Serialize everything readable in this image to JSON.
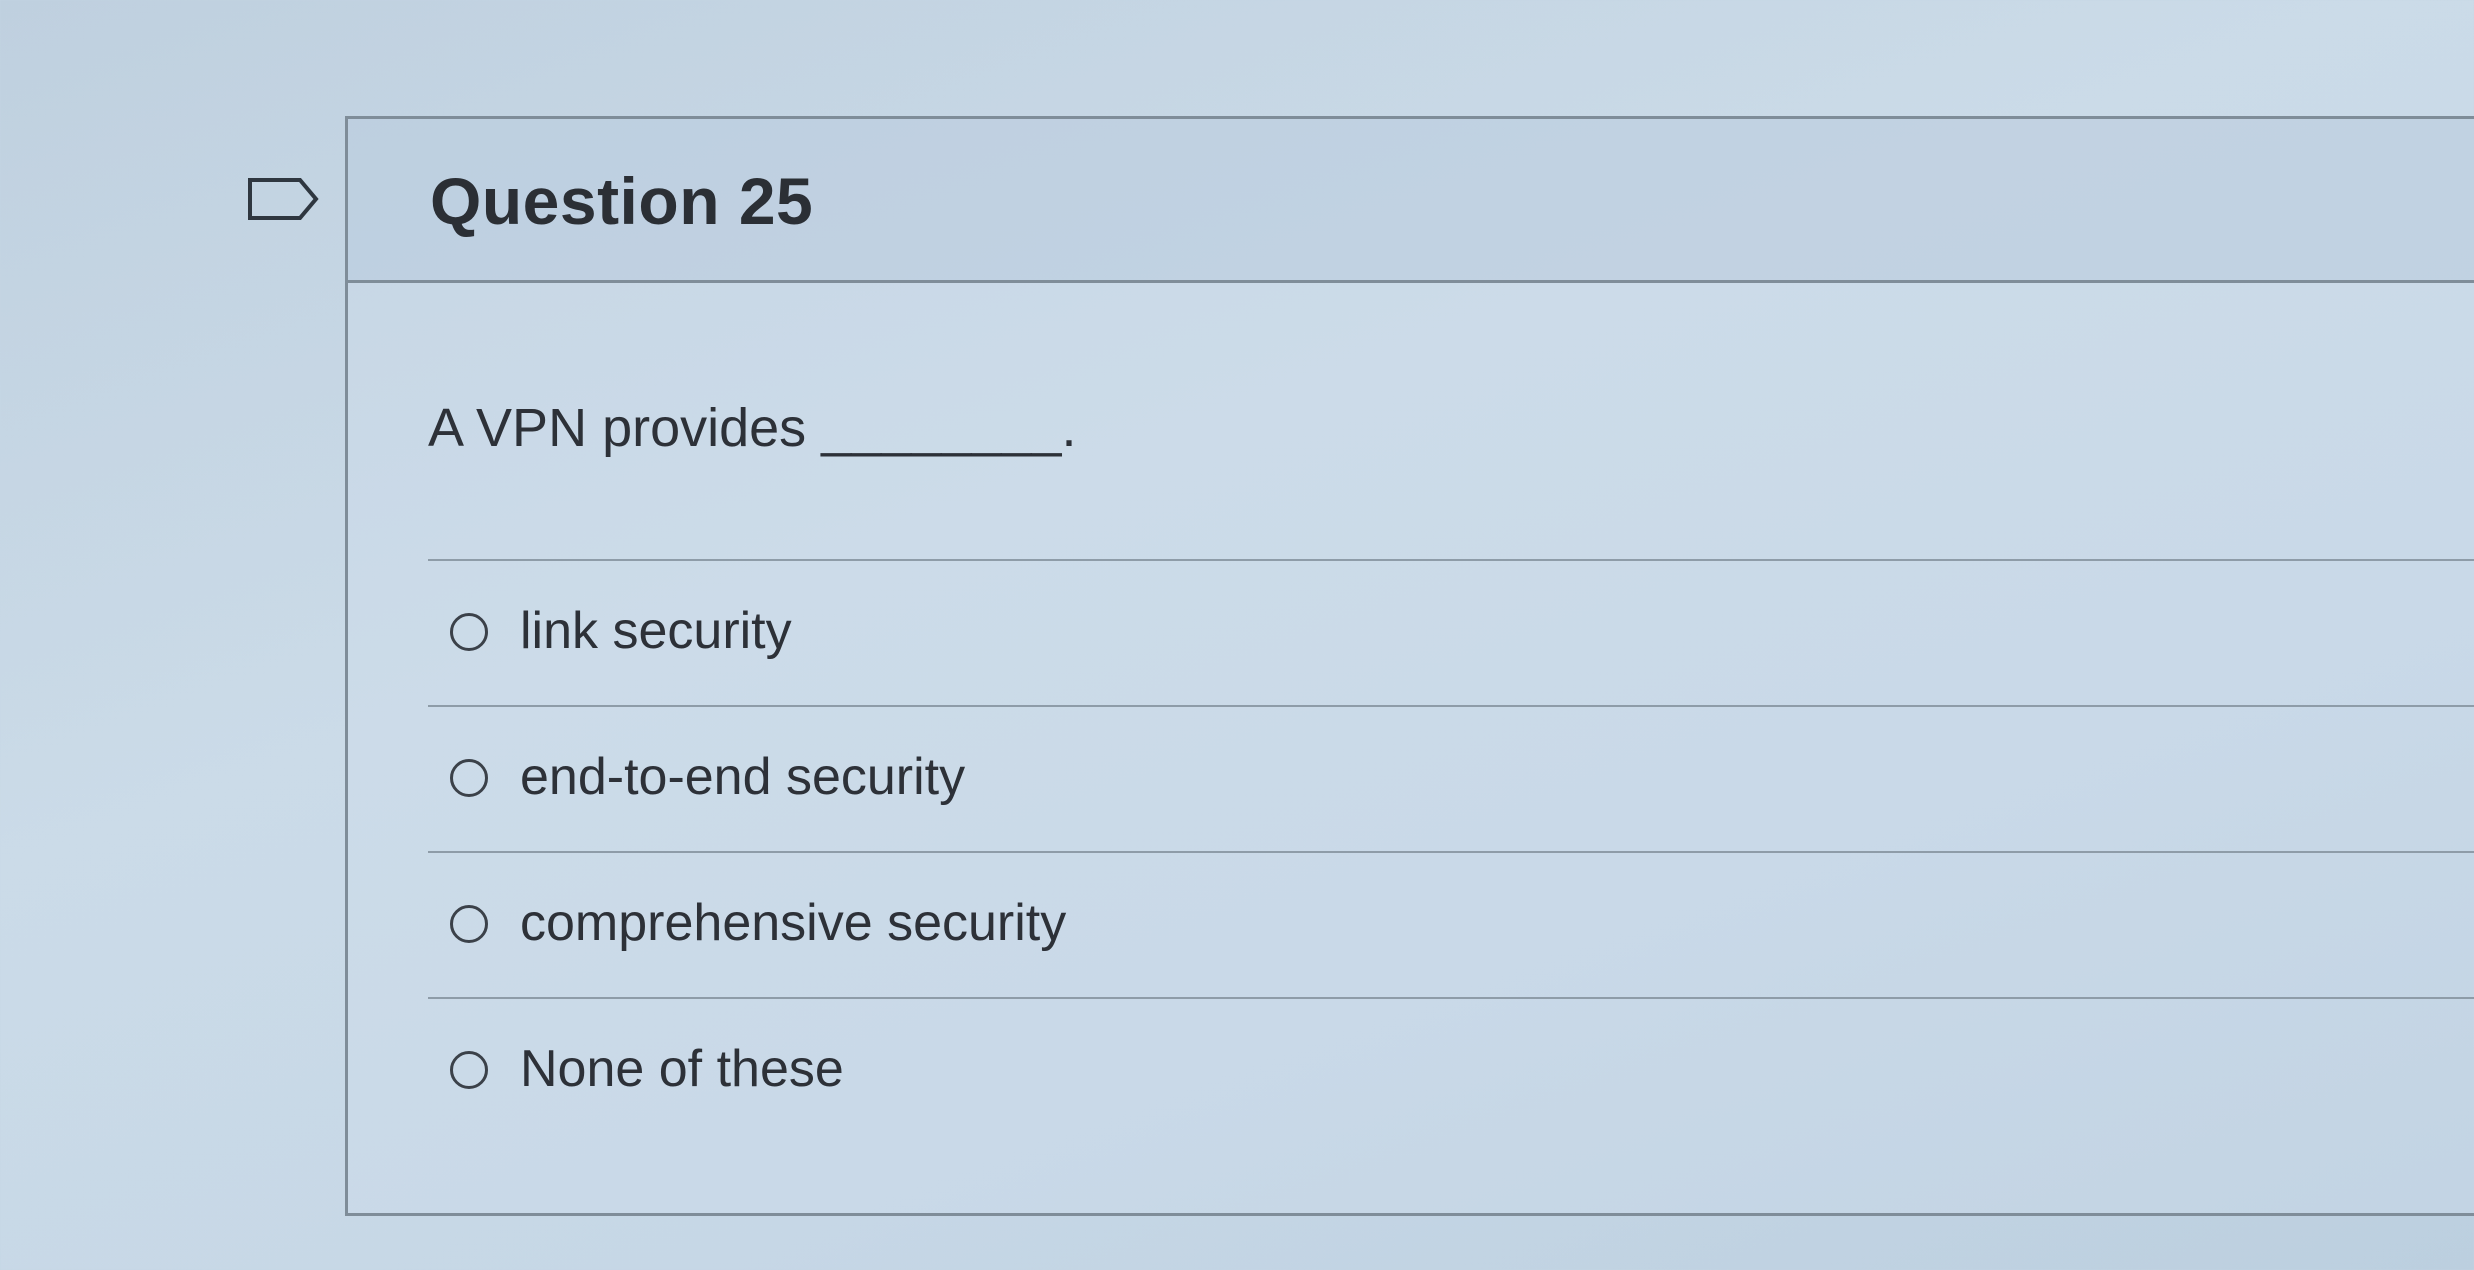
{
  "question": {
    "flag_icon": "flag-outline-icon",
    "title": "Question 25",
    "text": "A VPN provides ________.",
    "answers": [
      {
        "label": "link security",
        "selected": false
      },
      {
        "label": "end-to-end security",
        "selected": false
      },
      {
        "label": "comprehensive security",
        "selected": false
      },
      {
        "label": "None of these",
        "selected": false
      }
    ]
  },
  "colors": {
    "border": "#7f8d99",
    "text": "#2d3138",
    "background": "#c6d7e6"
  }
}
